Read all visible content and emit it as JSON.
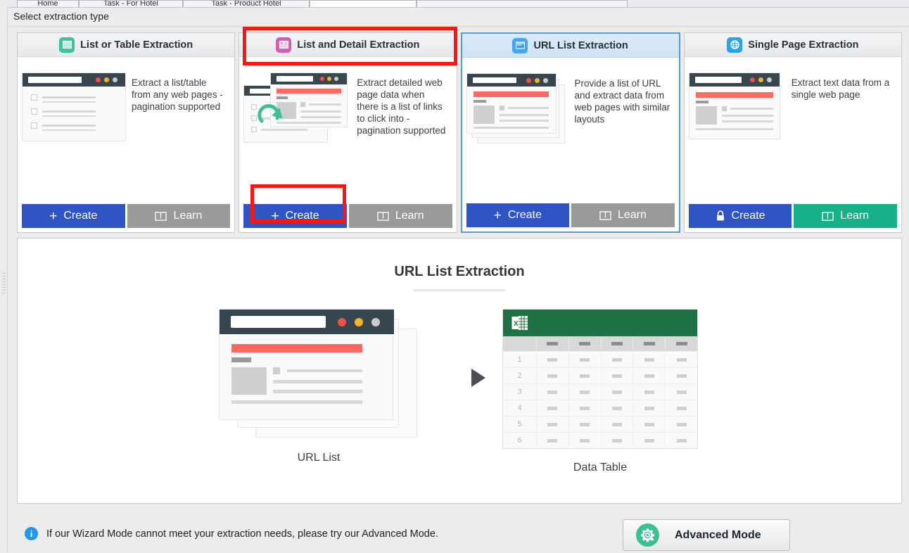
{
  "window": {
    "tabs": [
      "Home",
      "Task - For Hotel",
      "Task - Product Hotel",
      "",
      ""
    ]
  },
  "header": {
    "title": "Select extraction type"
  },
  "cards": [
    {
      "title": "List or Table Extraction",
      "icon": "table-icon",
      "icon_color": "#3fc0a0",
      "description": "Extract a list/table from any web pages - pagination supported",
      "create_label": "Create",
      "create_icon": "plus-icon",
      "learn_label": "Learn",
      "learn_icon": "book-icon",
      "selected": false,
      "create_color": "#2f54c4",
      "learn_color": "#9a9a9a"
    },
    {
      "title": "List and Detail Extraction",
      "icon": "list-detail-icon",
      "icon_color": "#d15fb0",
      "description": "Extract detailed web page data when there is a list of links to click into - pagination supported",
      "create_label": "Create",
      "create_icon": "plus-icon",
      "learn_label": "Learn",
      "learn_icon": "book-icon",
      "selected": false,
      "create_color": "#2f54c4",
      "learn_color": "#9a9a9a"
    },
    {
      "title": "URL List Extraction",
      "icon": "browser-window-icon",
      "icon_color": "#42a5f5",
      "description": "Provide a list of URL and extract data from web pages with similar layouts",
      "create_label": "Create",
      "create_icon": "plus-icon",
      "learn_label": "Learn",
      "learn_icon": "book-icon",
      "selected": true,
      "create_color": "#2f54c4",
      "learn_color": "#9a9a9a"
    },
    {
      "title": "Single Page Extraction",
      "icon": "globe-icon",
      "icon_color": "#29a3f0",
      "description": "Extract text data from a single web page",
      "create_label": "Create",
      "create_icon": "lock-icon",
      "learn_label": "Learn",
      "learn_icon": "book-icon",
      "selected": false,
      "create_color": "#2f54c4",
      "learn_color": "#17b088"
    }
  ],
  "preview": {
    "title": "URL List Extraction",
    "left_caption": "URL List",
    "right_caption": "Data Table",
    "arrow_icon": "play-arrow-icon",
    "table": {
      "row_labels": [
        "1",
        "2",
        "3",
        "4",
        "5",
        "6"
      ],
      "column_count": 5,
      "header_color": "#1e7145",
      "app_icon": "excel-icon"
    }
  },
  "footer": {
    "info_icon": "info-icon",
    "info_text": "If our Wizard Mode cannot meet your extraction needs, please try our Advanced Mode.",
    "advanced_label": "Advanced Mode",
    "advanced_icon": "gear-wrench-icon",
    "advanced_icon_color": "#3cbf95"
  },
  "annotations": {
    "highlight_color": "#fd1414",
    "boxes": [
      "list-and-detail-extraction-header",
      "list-and-detail-create-button"
    ]
  }
}
